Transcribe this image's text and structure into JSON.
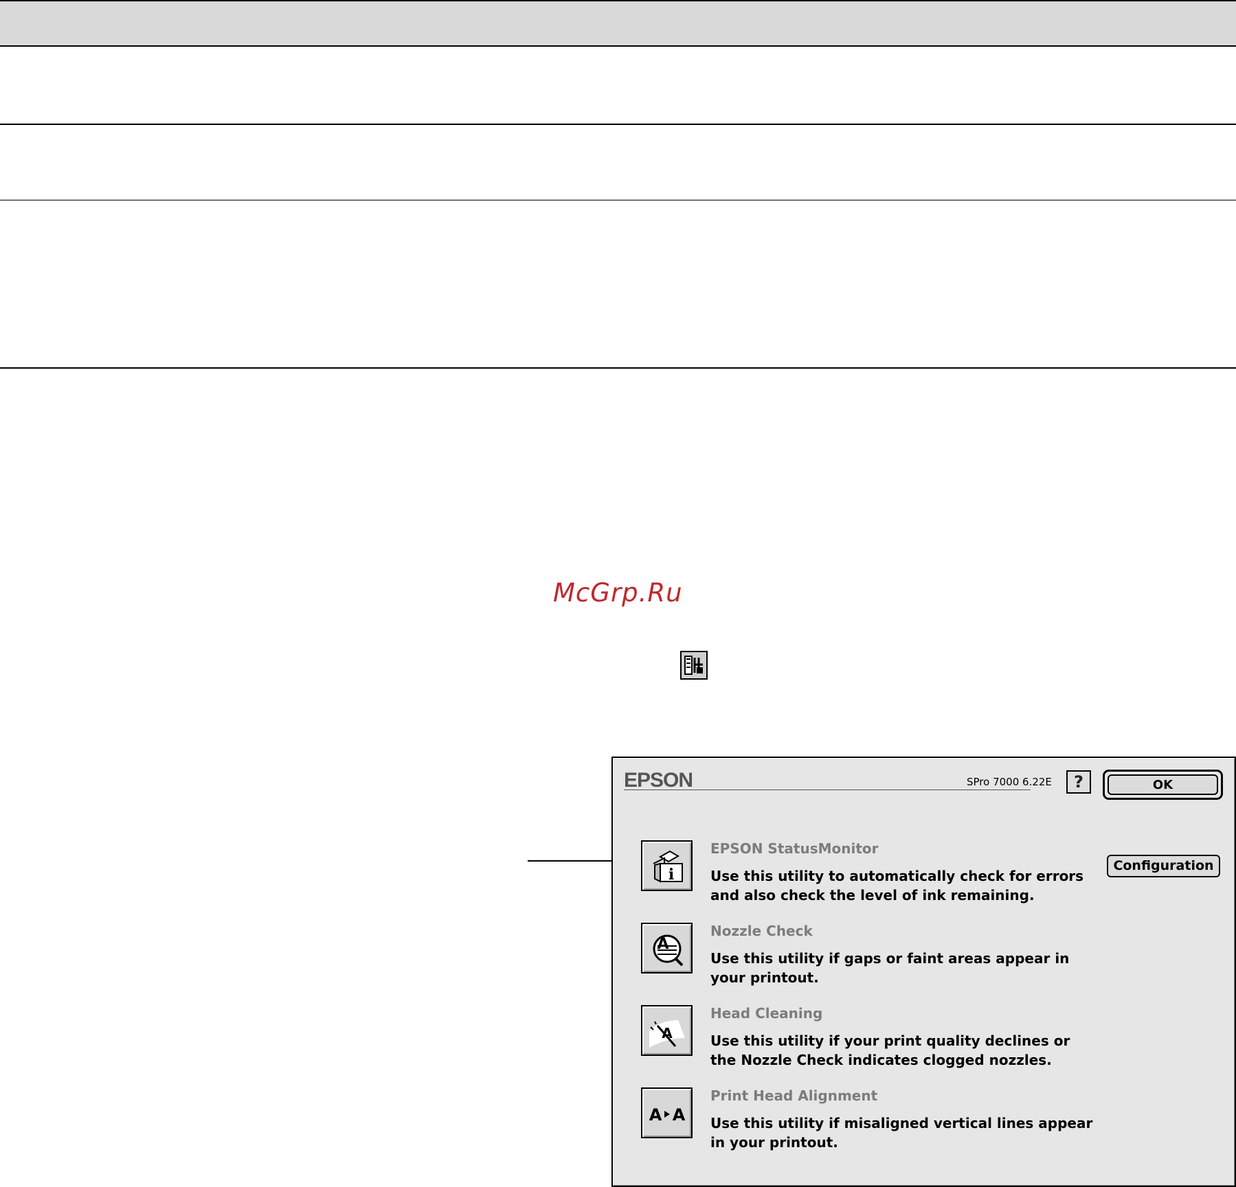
{
  "watermark": "McGrp.Ru",
  "dialog": {
    "brand": "EPSON",
    "version": "SPro 7000 6.22E",
    "help_label": "?",
    "ok_label": "OK",
    "configuration_label": "Configuration",
    "utilities": [
      {
        "title": "EPSON StatusMonitor",
        "description": "Use this utility to automatically check for errors and also check the level of ink remaining.",
        "icon": "status-monitor-icon"
      },
      {
        "title": "Nozzle Check",
        "description": "Use this utility if gaps or faint areas appear in your printout.",
        "icon": "nozzle-check-icon"
      },
      {
        "title": "Head Cleaning",
        "description": "Use this utility if your print quality declines or the Nozzle Check indicates clogged nozzles.",
        "icon": "head-cleaning-icon"
      },
      {
        "title": "Print Head Alignment",
        "description": "Use this utility if misaligned vertical lines appear in your printout.",
        "icon": "print-head-alignment-icon"
      }
    ]
  },
  "colors": {
    "title_gray": "#7c7c7c",
    "dialog_bg": "#e6e6e6",
    "watermark_red": "#c0272d"
  }
}
